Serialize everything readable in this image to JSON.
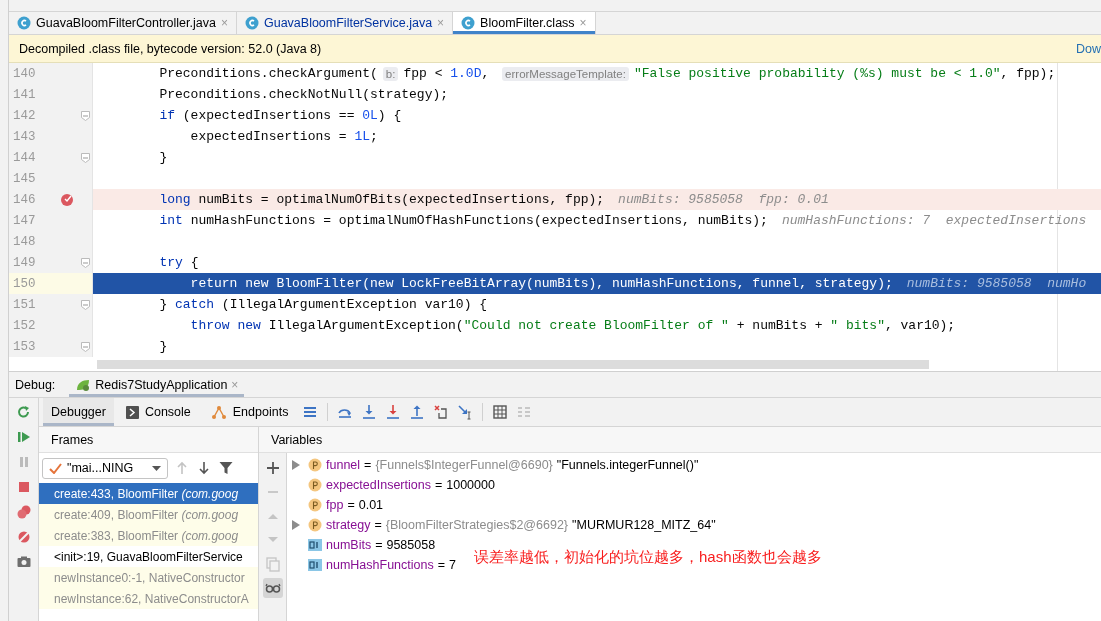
{
  "editor_tabs": [
    {
      "label": "GuavaBloomFilterController.java",
      "close": "×",
      "selected": false,
      "modified": false
    },
    {
      "label": "GuavaBloomFilterService.java",
      "close": "×",
      "selected": false,
      "modified": true
    },
    {
      "label": "BloomFilter.class",
      "close": "×",
      "selected": true,
      "modified": false
    }
  ],
  "banner": {
    "text": "Decompiled .class file, bytecode version: 52.0 (Java 8)",
    "link": "Dow"
  },
  "code_lines": [
    {
      "number": "140",
      "kind": "normal",
      "fold": false,
      "tokens": [
        {
          "kind": "code",
          "text": "        Preconditions.checkArgument("
        },
        {
          "kind": "param_hint",
          "text": "b:"
        },
        {
          "kind": "code",
          "text": "fpp < "
        },
        {
          "kind": "number",
          "text": "1.0D"
        },
        {
          "kind": "code",
          "text": ", "
        },
        {
          "kind": "param_hint",
          "text": "errorMessageTemplate:"
        },
        {
          "kind": "string",
          "text": "\"False positive probability (%s) must be < 1.0\""
        },
        {
          "kind": "code",
          "text": ", fpp);"
        }
      ]
    },
    {
      "number": "141",
      "kind": "normal",
      "fold": false,
      "tokens": [
        {
          "kind": "code",
          "text": "        Preconditions.checkNotNull(strategy);"
        }
      ]
    },
    {
      "number": "142",
      "kind": "normal",
      "fold": true,
      "tokens": [
        {
          "kind": "keyword",
          "text": "        if"
        },
        {
          "kind": "code",
          "text": " (expectedInsertions == "
        },
        {
          "kind": "number",
          "text": "0L"
        },
        {
          "kind": "code",
          "text": ") {"
        }
      ]
    },
    {
      "number": "143",
      "kind": "normal",
      "fold": false,
      "tokens": [
        {
          "kind": "code",
          "text": "            expectedInsertions = "
        },
        {
          "kind": "number",
          "text": "1L"
        },
        {
          "kind": "code",
          "text": ";"
        }
      ]
    },
    {
      "number": "144",
      "kind": "normal",
      "fold": true,
      "tokens": [
        {
          "kind": "code",
          "text": "        }"
        }
      ]
    },
    {
      "number": "145",
      "kind": "normal",
      "fold": false
    },
    {
      "number": "146",
      "kind": "breakpoint",
      "fold": false,
      "tokens": [
        {
          "kind": "keyword",
          "text": "        long"
        },
        {
          "kind": "code",
          "text": " numBits = optimalNumOfBits(expectedInsertions, fpp);"
        },
        {
          "kind": "value_hint",
          "text": "numBits: 9585058  fpp: 0.01"
        }
      ]
    },
    {
      "number": "147",
      "kind": "normal",
      "fold": false,
      "tokens": [
        {
          "kind": "keyword",
          "text": "        int"
        },
        {
          "kind": "code",
          "text": " numHashFunctions = optimalNumOfHashFunctions(expectedInsertions, numBits);"
        },
        {
          "kind": "value_hint",
          "text": "numHashFunctions: 7  expectedInsertions"
        }
      ]
    },
    {
      "number": "148",
      "kind": "normal",
      "fold": false
    },
    {
      "number": "149",
      "kind": "normal",
      "fold": true,
      "tokens": [
        {
          "kind": "keyword",
          "text": "        try"
        },
        {
          "kind": "code",
          "text": " {"
        }
      ]
    },
    {
      "number": "150",
      "kind": "execution",
      "fold": false,
      "tokens": [
        {
          "kind": "keyword",
          "text": "            return new"
        },
        {
          "kind": "code",
          "text": " BloomFilter("
        },
        {
          "kind": "keyword",
          "text": "new"
        },
        {
          "kind": "code",
          "text": " LockFreeBitArray(numBits), numHashFunctions, funnel, strategy);"
        },
        {
          "kind": "value_hint",
          "text": "numBits: 9585058  numHo"
        }
      ]
    },
    {
      "number": "151",
      "kind": "normal",
      "fold": true,
      "tokens": [
        {
          "kind": "code",
          "text": "        } "
        },
        {
          "kind": "keyword",
          "text": "catch"
        },
        {
          "kind": "code",
          "text": " (IllegalArgumentException var10) {"
        }
      ]
    },
    {
      "number": "152",
      "kind": "normal",
      "fold": false,
      "tokens": [
        {
          "kind": "keyword",
          "text": "            throw new"
        },
        {
          "kind": "code",
          "text": " IllegalArgumentException("
        },
        {
          "kind": "string",
          "text": "\"Could not create BloomFilter of \""
        },
        {
          "kind": "code",
          "text": " + numBits + "
        },
        {
          "kind": "string",
          "text": "\" bits\""
        },
        {
          "kind": "code",
          "text": ", var10);"
        }
      ]
    },
    {
      "number": "153",
      "kind": "normal",
      "fold": true,
      "tokens": [
        {
          "kind": "code",
          "text": "        }"
        }
      ]
    }
  ],
  "debug": {
    "label": "Debug:",
    "session": "Redis7StudyApplication",
    "session_close": "×",
    "tabs": [
      {
        "label": "Debugger",
        "kind": "debugger",
        "selected": true
      },
      {
        "label": "Console",
        "kind": "console",
        "selected": false
      },
      {
        "label": "Endpoints",
        "kind": "endpoints",
        "selected": false
      }
    ],
    "frames": {
      "title": "Frames",
      "thread": "\"mai...NING",
      "items": [
        {
          "method": "create:433, BloomFilter",
          "package": "(com.goog",
          "library": true,
          "selected": true
        },
        {
          "method": "create:409, BloomFilter",
          "package": "(com.goog",
          "library": true,
          "selected": false
        },
        {
          "method": "create:383, BloomFilter",
          "package": "(com.goog",
          "library": true,
          "selected": false
        },
        {
          "method": "<init>:19, GuavaBloomFilterService",
          "library": false,
          "selected": false
        },
        {
          "method": "newInstance0:-1, NativeConstructor",
          "library": true,
          "selected": false
        },
        {
          "method": "newInstance:62, NativeConstructorA",
          "library": true,
          "selected": false
        }
      ]
    },
    "variables": {
      "title": "Variables",
      "items": [
        {
          "kind": "param",
          "expandable": true,
          "name": "funnel",
          "equals": "=",
          "ref": "{Funnels$IntegerFunnel@6690}",
          "value": "\"Funnels.integerFunnel()\""
        },
        {
          "kind": "param",
          "expandable": false,
          "name": "expectedInsertions",
          "equals": "=",
          "value": "1000000"
        },
        {
          "kind": "param",
          "expandable": false,
          "name": "fpp",
          "equals": "=",
          "value": "0.01"
        },
        {
          "kind": "param",
          "expandable": true,
          "name": "strategy",
          "equals": "=",
          "ref": "{BloomFilterStrategies$2@6692}",
          "value": "\"MURMUR128_MITZ_64\""
        },
        {
          "kind": "primitive",
          "expandable": false,
          "name": "numBits",
          "equals": "=",
          "value": "9585058"
        },
        {
          "kind": "primitive",
          "expandable": false,
          "name": "numHashFunctions",
          "equals": "=",
          "value": "7"
        }
      ],
      "note": "误差率越低，初始化的坑位越多，hash函数也会越多"
    }
  }
}
